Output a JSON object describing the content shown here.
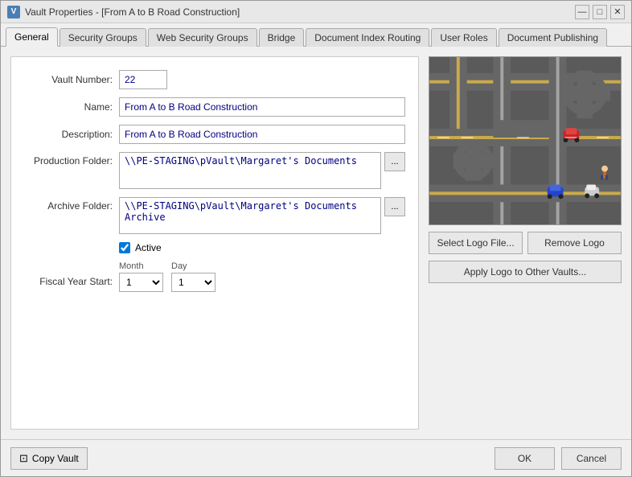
{
  "window": {
    "title": "Vault Properties - [From A to B Road Construction]",
    "icon": "V"
  },
  "title_buttons": {
    "minimize": "—",
    "maximize": "□",
    "close": "✕"
  },
  "tabs": [
    {
      "label": "General",
      "active": true
    },
    {
      "label": "Security Groups",
      "active": false
    },
    {
      "label": "Web Security Groups",
      "active": false
    },
    {
      "label": "Bridge",
      "active": false
    },
    {
      "label": "Document Index Routing",
      "active": false
    },
    {
      "label": "User Roles",
      "active": false
    },
    {
      "label": "Document Publishing",
      "active": false
    }
  ],
  "form": {
    "vault_number_label": "Vault Number:",
    "vault_number_value": "22",
    "name_label": "Name:",
    "name_value": "From A to B Road Construction",
    "description_label": "Description:",
    "description_value": "From A to B Road Construction",
    "production_folder_label": "Production Folder:",
    "production_folder_value": "\\\\PE-STAGING\\pVault\\Margaret's Documents",
    "archive_folder_label": "Archive Folder:",
    "archive_folder_value": "\\\\PE-STAGING\\pVault\\Margaret's Documents Archive",
    "active_label": "Active",
    "fiscal_year_label": "Fiscal Year Start:",
    "month_label": "Month",
    "day_label": "Day",
    "month_value": "1",
    "day_value": "1",
    "browse_label": "..."
  },
  "logo": {
    "select_file_label": "Select Logo File...",
    "remove_label": "Remove Logo",
    "apply_label": "Apply Logo to Other Vaults..."
  },
  "footer": {
    "copy_vault_label": "Copy Vault",
    "ok_label": "OK",
    "cancel_label": "Cancel"
  }
}
